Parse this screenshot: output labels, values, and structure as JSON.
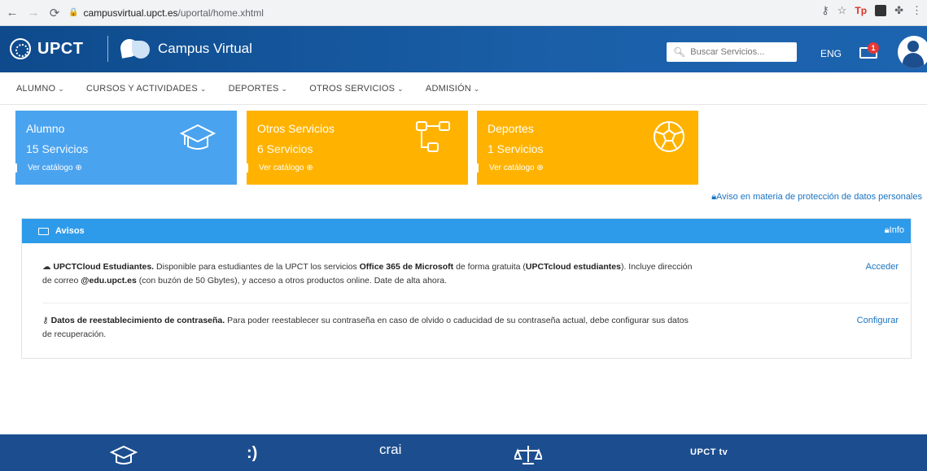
{
  "browser": {
    "url_host": "campusvirtual.upct.es",
    "url_path": "/uportal/home.xhtml",
    "ext_tp": "Tp"
  },
  "header": {
    "brand": "UPCT",
    "app_name": "Campus Virtual",
    "search_placeholder": "Buscar Servicios...",
    "lang": "ENG",
    "notification_count": "1"
  },
  "menu": [
    {
      "label": "ALUMNO"
    },
    {
      "label": "CURSOS Y ACTIVIDADES"
    },
    {
      "label": "DEPORTES"
    },
    {
      "label": "OTROS SERVICIOS"
    },
    {
      "label": "ADMISIÓN"
    }
  ],
  "cards": [
    {
      "title": "Alumno",
      "count": "15 Servicios",
      "link": "Ver catálogo ⊕",
      "color": "#4aa3ef",
      "icon": "graduation-cap-icon"
    },
    {
      "title": "Otros Servicios",
      "count": "6 Servicios",
      "link": "Ver catálogo ⊕",
      "color": "#ffb300",
      "icon": "flow-diagram-icon"
    },
    {
      "title": "Deportes",
      "count": "1 Servicios",
      "link": "Ver catálogo ⊕",
      "color": "#ffb300",
      "icon": "soccer-ball-icon"
    }
  ],
  "privacy_link": "Aviso en materia de protección de datos personales",
  "avisos": {
    "title": "Avisos",
    "info": "Info",
    "items": [
      {
        "title": "UPCTCloud Estudiantes.",
        "text_a": " Disponible para estudiantes de la UPCT los servicios ",
        "bold_b": "Office 365 de Microsoft",
        "text_c": " de forma gratuita (",
        "bold_d": "UPCTcloud estudiantes",
        "text_e": "). Incluye dirección de correo ",
        "bold_f": "@edu.upct.es",
        "text_g": " (con buzón de 50 Gbytes), y acceso a otros productos online. Date de alta ahora.",
        "action": "Acceder"
      },
      {
        "title": "Datos de reestablecimiento de contraseña.",
        "text_a": " Para poder reestablecer su contraseña en caso de olvido o caducidad de su contraseña actual, debe configurar sus datos de recuperación.",
        "action": "Configurar"
      }
    ]
  },
  "footer": {
    "icons": [
      "graduation-cap-icon",
      "smile-icon",
      "crai-icon",
      "scales-icon",
      "upcttv-icon"
    ],
    "crai": "crai",
    "upcttv": "UPCT tv"
  }
}
